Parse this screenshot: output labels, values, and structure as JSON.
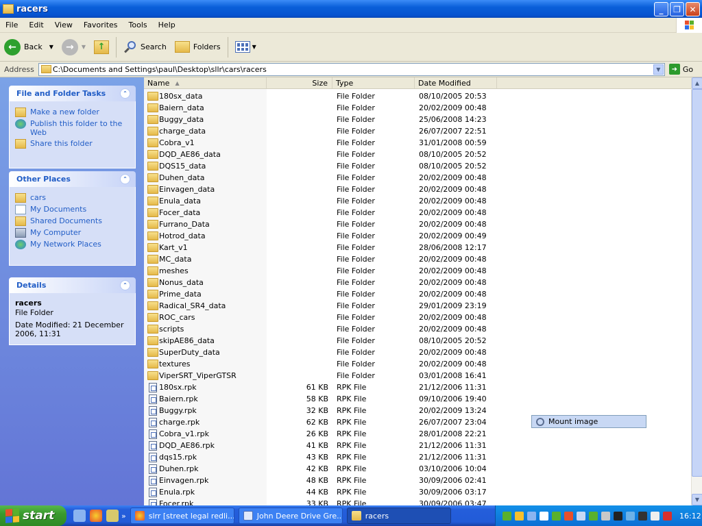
{
  "window": {
    "title": "racers"
  },
  "menu": [
    "File",
    "Edit",
    "View",
    "Favorites",
    "Tools",
    "Help"
  ],
  "toolbar": {
    "back": "Back",
    "search": "Search",
    "folders": "Folders"
  },
  "address": {
    "label": "Address",
    "value": "C:\\Documents and Settings\\paul\\Desktop\\sllr\\cars\\racers",
    "go": "Go"
  },
  "tasks_panel": {
    "title": "File and Folder Tasks",
    "items": [
      "Make a new folder",
      "Publish this folder to the Web",
      "Share this folder"
    ]
  },
  "places_panel": {
    "title": "Other Places",
    "items": [
      "cars",
      "My Documents",
      "Shared Documents",
      "My Computer",
      "My Network Places"
    ]
  },
  "details_panel": {
    "title": "Details",
    "name": "racers",
    "type": "File Folder",
    "modified": "Date Modified: 21 December 2006, 11:31"
  },
  "columns": {
    "name": "Name",
    "size": "Size",
    "type": "Type",
    "date": "Date Modified"
  },
  "files": [
    {
      "name": "180sx_data",
      "size": "",
      "type": "File Folder",
      "date": "08/10/2005 20:53",
      "kind": "folder"
    },
    {
      "name": "Baiern_data",
      "size": "",
      "type": "File Folder",
      "date": "20/02/2009 00:48",
      "kind": "folder"
    },
    {
      "name": "Buggy_data",
      "size": "",
      "type": "File Folder",
      "date": "25/06/2008 14:23",
      "kind": "folder"
    },
    {
      "name": "charge_data",
      "size": "",
      "type": "File Folder",
      "date": "26/07/2007 22:51",
      "kind": "folder"
    },
    {
      "name": "Cobra_v1",
      "size": "",
      "type": "File Folder",
      "date": "31/01/2008 00:59",
      "kind": "folder"
    },
    {
      "name": "DQD_AE86_data",
      "size": "",
      "type": "File Folder",
      "date": "08/10/2005 20:52",
      "kind": "folder"
    },
    {
      "name": "DQS15_data",
      "size": "",
      "type": "File Folder",
      "date": "08/10/2005 20:52",
      "kind": "folder"
    },
    {
      "name": "Duhen_data",
      "size": "",
      "type": "File Folder",
      "date": "20/02/2009 00:48",
      "kind": "folder"
    },
    {
      "name": "Einvagen_data",
      "size": "",
      "type": "File Folder",
      "date": "20/02/2009 00:48",
      "kind": "folder"
    },
    {
      "name": "Enula_data",
      "size": "",
      "type": "File Folder",
      "date": "20/02/2009 00:48",
      "kind": "folder"
    },
    {
      "name": "Focer_data",
      "size": "",
      "type": "File Folder",
      "date": "20/02/2009 00:48",
      "kind": "folder"
    },
    {
      "name": "Furrano_Data",
      "size": "",
      "type": "File Folder",
      "date": "20/02/2009 00:48",
      "kind": "folder"
    },
    {
      "name": "Hotrod_data",
      "size": "",
      "type": "File Folder",
      "date": "20/02/2009 00:49",
      "kind": "folder"
    },
    {
      "name": "Kart_v1",
      "size": "",
      "type": "File Folder",
      "date": "28/06/2008 12:17",
      "kind": "folder"
    },
    {
      "name": "MC_data",
      "size": "",
      "type": "File Folder",
      "date": "20/02/2009 00:48",
      "kind": "folder"
    },
    {
      "name": "meshes",
      "size": "",
      "type": "File Folder",
      "date": "20/02/2009 00:48",
      "kind": "folder"
    },
    {
      "name": "Nonus_data",
      "size": "",
      "type": "File Folder",
      "date": "20/02/2009 00:48",
      "kind": "folder"
    },
    {
      "name": "Prime_data",
      "size": "",
      "type": "File Folder",
      "date": "20/02/2009 00:48",
      "kind": "folder"
    },
    {
      "name": "Radical_SR4_data",
      "size": "",
      "type": "File Folder",
      "date": "29/01/2009 23:19",
      "kind": "folder"
    },
    {
      "name": "ROC_cars",
      "size": "",
      "type": "File Folder",
      "date": "20/02/2009 00:48",
      "kind": "folder"
    },
    {
      "name": "scripts",
      "size": "",
      "type": "File Folder",
      "date": "20/02/2009 00:48",
      "kind": "folder"
    },
    {
      "name": "skipAE86_data",
      "size": "",
      "type": "File Folder",
      "date": "08/10/2005 20:52",
      "kind": "folder"
    },
    {
      "name": "SuperDuty_data",
      "size": "",
      "type": "File Folder",
      "date": "20/02/2009 00:48",
      "kind": "folder"
    },
    {
      "name": "textures",
      "size": "",
      "type": "File Folder",
      "date": "20/02/2009 00:48",
      "kind": "folder"
    },
    {
      "name": "ViperSRT_ViperGTSR",
      "size": "",
      "type": "File Folder",
      "date": "03/01/2008 16:41",
      "kind": "folder"
    },
    {
      "name": "180sx.rpk",
      "size": "61 KB",
      "type": "RPK File",
      "date": "21/12/2006 11:31",
      "kind": "rpk"
    },
    {
      "name": "Baiern.rpk",
      "size": "58 KB",
      "type": "RPK File",
      "date": "09/10/2006 19:40",
      "kind": "rpk"
    },
    {
      "name": "Buggy.rpk",
      "size": "32 KB",
      "type": "RPK File",
      "date": "20/02/2009 13:24",
      "kind": "rpk"
    },
    {
      "name": "charge.rpk",
      "size": "62 KB",
      "type": "RPK File",
      "date": "26/07/2007 23:04",
      "kind": "rpk"
    },
    {
      "name": "Cobra_v1.rpk",
      "size": "26 KB",
      "type": "RPK File",
      "date": "28/01/2008 22:21",
      "kind": "rpk"
    },
    {
      "name": "DQD_AE86.rpk",
      "size": "41 KB",
      "type": "RPK File",
      "date": "21/12/2006 11:31",
      "kind": "rpk"
    },
    {
      "name": "dqs15.rpk",
      "size": "43 KB",
      "type": "RPK File",
      "date": "21/12/2006 11:31",
      "kind": "rpk"
    },
    {
      "name": "Duhen.rpk",
      "size": "42 KB",
      "type": "RPK File",
      "date": "03/10/2006 10:04",
      "kind": "rpk"
    },
    {
      "name": "Einvagen.rpk",
      "size": "48 KB",
      "type": "RPK File",
      "date": "30/09/2006 02:41",
      "kind": "rpk"
    },
    {
      "name": "Enula.rpk",
      "size": "44 KB",
      "type": "RPK File",
      "date": "30/09/2006 03:17",
      "kind": "rpk"
    },
    {
      "name": "Focer.rpk",
      "size": "33 KB",
      "type": "RPK File",
      "date": "30/09/2006 03:47",
      "kind": "rpk"
    }
  ],
  "context_menu": {
    "item": "Mount image"
  },
  "taskbar": {
    "start": "start",
    "tasks": [
      "slrr [street legal redli...",
      "John Deere Drive Gre...",
      "racers"
    ],
    "clock": "16:12"
  },
  "colors": {
    "title_blue": "#0a5fd9",
    "panel_blue": "#215dc6",
    "start_green": "#3a9a2e"
  }
}
